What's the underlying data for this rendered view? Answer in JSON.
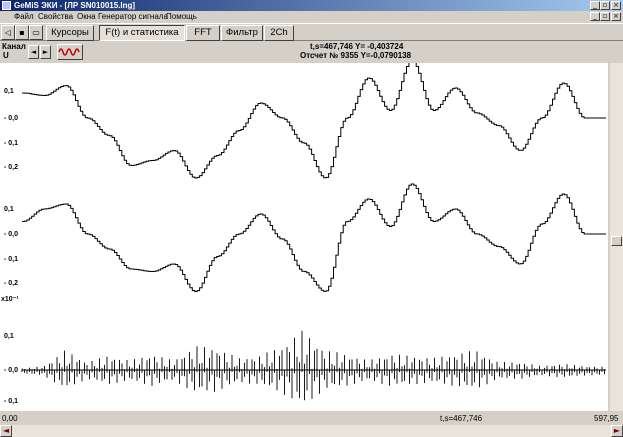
{
  "window": {
    "title": "GeMiS ЭКИ - [ЛР SN010015.lng]",
    "min_icon": "minimize-icon",
    "restore_icon": "restore-icon",
    "close_icon": "close-icon"
  },
  "menu": [
    "Файл",
    "Свойства",
    "Окна",
    "Генератор сигнала",
    "Помощь"
  ],
  "toolbar": {
    "tabs": [
      "Курсоры",
      "F(t) и статистика",
      "FFT",
      "Фильтр",
      "2Ch"
    ],
    "active_tab": "F(t) и статистика"
  },
  "channel": {
    "label": "Канал",
    "value": "U",
    "prev_icon": "arrow-left-icon",
    "next_icon": "arrow-right-icon",
    "wave_icon": "waveform-icon"
  },
  "readout": {
    "line1": "t,s=467,746  Y= -0,403724",
    "line2": "Отсчет № 9355 Y=-0,0790138"
  },
  "axes": {
    "panel1": [
      "0,1",
      "- 0,0",
      "- 0,1",
      "- 0,2"
    ],
    "panel2": [
      "0,1",
      "- 0,0",
      "- 0,1",
      "- 0,2"
    ],
    "panel3_exp": "x10⁻¹",
    "panel3": [
      "0,1",
      "- 0,0",
      "- 0,1"
    ]
  },
  "status": {
    "left": "0,00",
    "cursor": "t,s=467,746",
    "right": "597,95"
  },
  "chart_data": {
    "type": "line",
    "x_range": [
      0,
      597.95
    ],
    "series": [
      {
        "panel": 1,
        "values": [
          0.1,
          0.09,
          0.13,
          0.0,
          -0.07,
          -0.19,
          -0.17,
          -0.13,
          -0.24,
          -0.15,
          -0.05,
          0.06,
          0.0,
          -0.1,
          -0.24,
          0.0,
          0.16,
          0.03,
          0.23,
          0.03,
          0.12,
          0.02,
          -0.03,
          -0.13,
          0.0,
          0.14,
          0.0,
          0.0
        ]
      },
      {
        "panel": 2,
        "values": [
          0.05,
          0.1,
          0.12,
          0.0,
          -0.06,
          -0.14,
          -0.15,
          -0.12,
          -0.23,
          -0.09,
          0.0,
          0.08,
          -0.02,
          -0.15,
          -0.23,
          0.05,
          0.14,
          0.03,
          0.2,
          0.05,
          0.1,
          0.0,
          -0.05,
          -0.12,
          0.04,
          0.16,
          0.0,
          0.0
        ]
      },
      {
        "panel": 3,
        "values": [
          0.02,
          0.05,
          0.25,
          0.1,
          0.18,
          0.12,
          0.2,
          0.12,
          0.3,
          0.28,
          0.15,
          0.18,
          0.3,
          0.5,
          0.25,
          0.2,
          0.12,
          0.2,
          0.18,
          0.15,
          0.2,
          0.25,
          0.1,
          0.1,
          0.05,
          0.08,
          0.05,
          0.04
        ]
      }
    ]
  }
}
